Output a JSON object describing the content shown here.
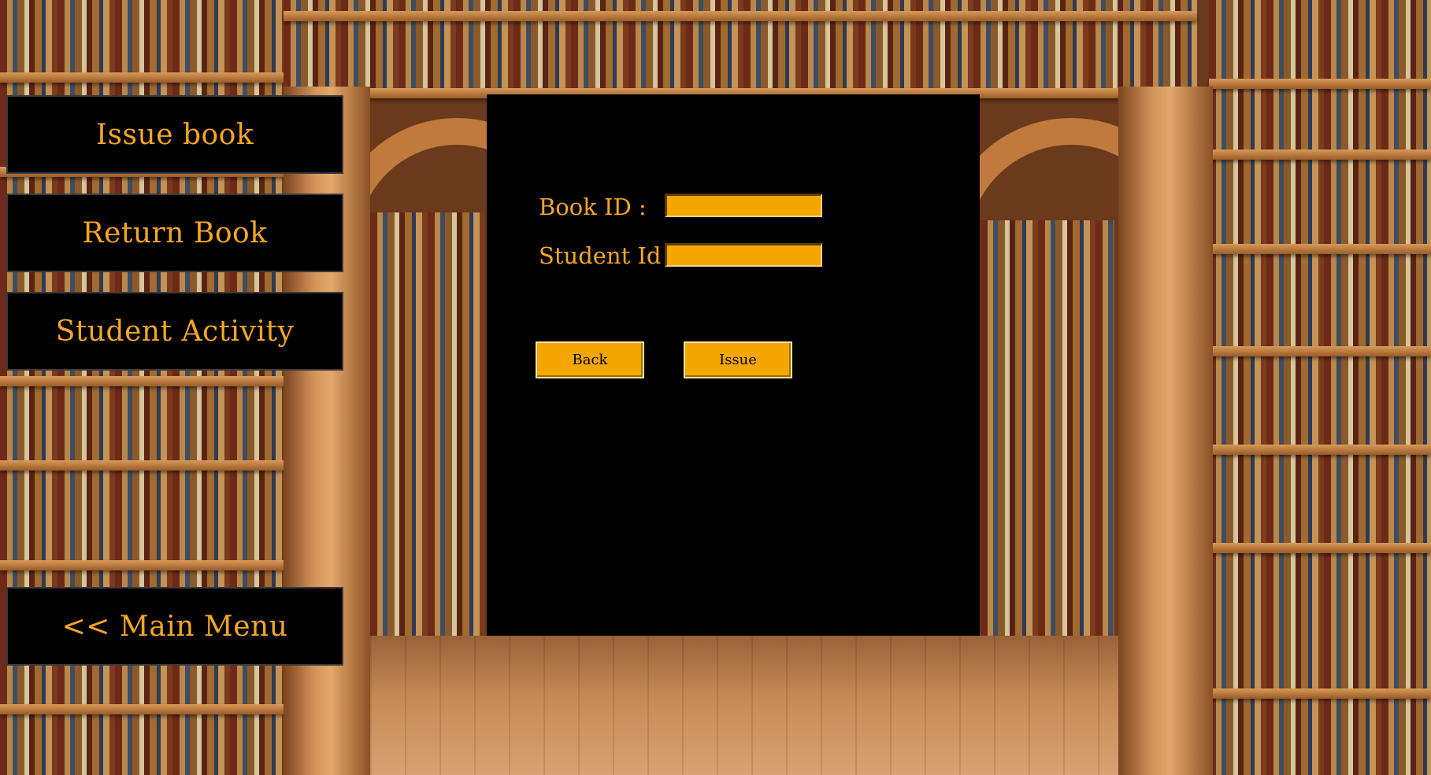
{
  "nav": {
    "issue_book": "Issue book",
    "return_book": "Return Book",
    "student_activity": "Student Activity",
    "main_menu": "<< Main Menu"
  },
  "form": {
    "book_id_label": "Book ID :",
    "book_id_value": "",
    "student_id_label": "Student Id :",
    "student_id_value": "",
    "back_label": "Back",
    "issue_label": "Issue"
  },
  "colors": {
    "accent": "#f5a623",
    "input_fill": "#f5a600",
    "panel": "#000000"
  }
}
